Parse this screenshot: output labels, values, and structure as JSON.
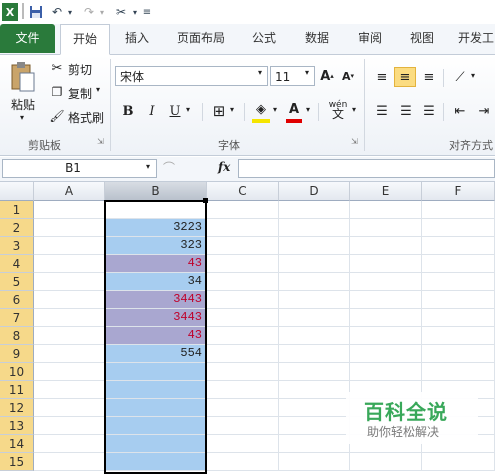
{
  "ribbon_tabs": [
    "文件",
    "开始",
    "插入",
    "页面布局",
    "公式",
    "数据",
    "审阅",
    "视图",
    "开发工"
  ],
  "clipboard": {
    "paste": "粘贴",
    "cut": "剪切",
    "copy": "复制",
    "format_painter": "格式刷",
    "group": "剪贴板"
  },
  "font": {
    "name": "宋体",
    "size": "11",
    "group": "字体"
  },
  "alignment": {
    "group": "对齐方式"
  },
  "formula_bar": {
    "name_box": "B1",
    "fx": "fx",
    "value": ""
  },
  "columns": [
    "A",
    "B",
    "C",
    "D",
    "E",
    "F"
  ],
  "rows": [
    "1",
    "2",
    "3",
    "4",
    "5",
    "6",
    "7",
    "8",
    "9",
    "10",
    "11",
    "12",
    "13",
    "14",
    "15"
  ],
  "column_b_values": [
    "",
    "3223",
    "323",
    "43",
    "34",
    "3443",
    "3443",
    "43",
    "554",
    "",
    "",
    "",
    "",
    "",
    ""
  ],
  "highlighted_rows": [
    3,
    5,
    6,
    7
  ],
  "watermark": {
    "title": "百科全说",
    "subtitle": "助你轻松解决"
  },
  "colors": {
    "file_tab": "#2a7a3b",
    "selection": "#a7cdf0",
    "highlight": "#a9a7d0",
    "red_text": "#c0002a",
    "row_header_selected": "#f6d98a"
  }
}
